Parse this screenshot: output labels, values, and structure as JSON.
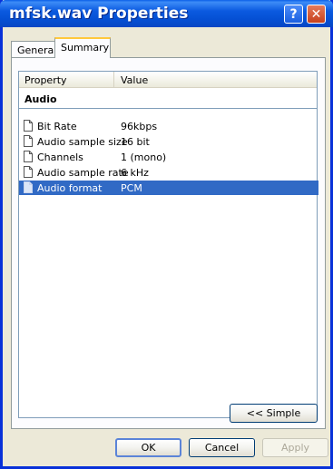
{
  "window": {
    "title": "mfsk.wav Properties"
  },
  "titlebar_buttons": {
    "help": "?",
    "close": "✕"
  },
  "tabs": [
    {
      "label": "General"
    },
    {
      "label": "Summary"
    }
  ],
  "list": {
    "columns": {
      "property": "Property",
      "value": "Value"
    },
    "group": "Audio",
    "rows": [
      {
        "property": "Bit Rate",
        "value": "96kbps"
      },
      {
        "property": "Audio sample size",
        "value": "16 bit"
      },
      {
        "property": "Channels",
        "value": "1 (mono)"
      },
      {
        "property": "Audio sample rate",
        "value": "6 kHz"
      },
      {
        "property": "Audio format",
        "value": "PCM",
        "selected": true
      }
    ]
  },
  "buttons": {
    "simple": "<< Simple",
    "ok": "OK",
    "cancel": "Cancel",
    "apply": "Apply"
  },
  "colors": {
    "titlebar": "#0550d4",
    "selection": "#316ac5",
    "tab_highlight": "#ffc83c"
  }
}
